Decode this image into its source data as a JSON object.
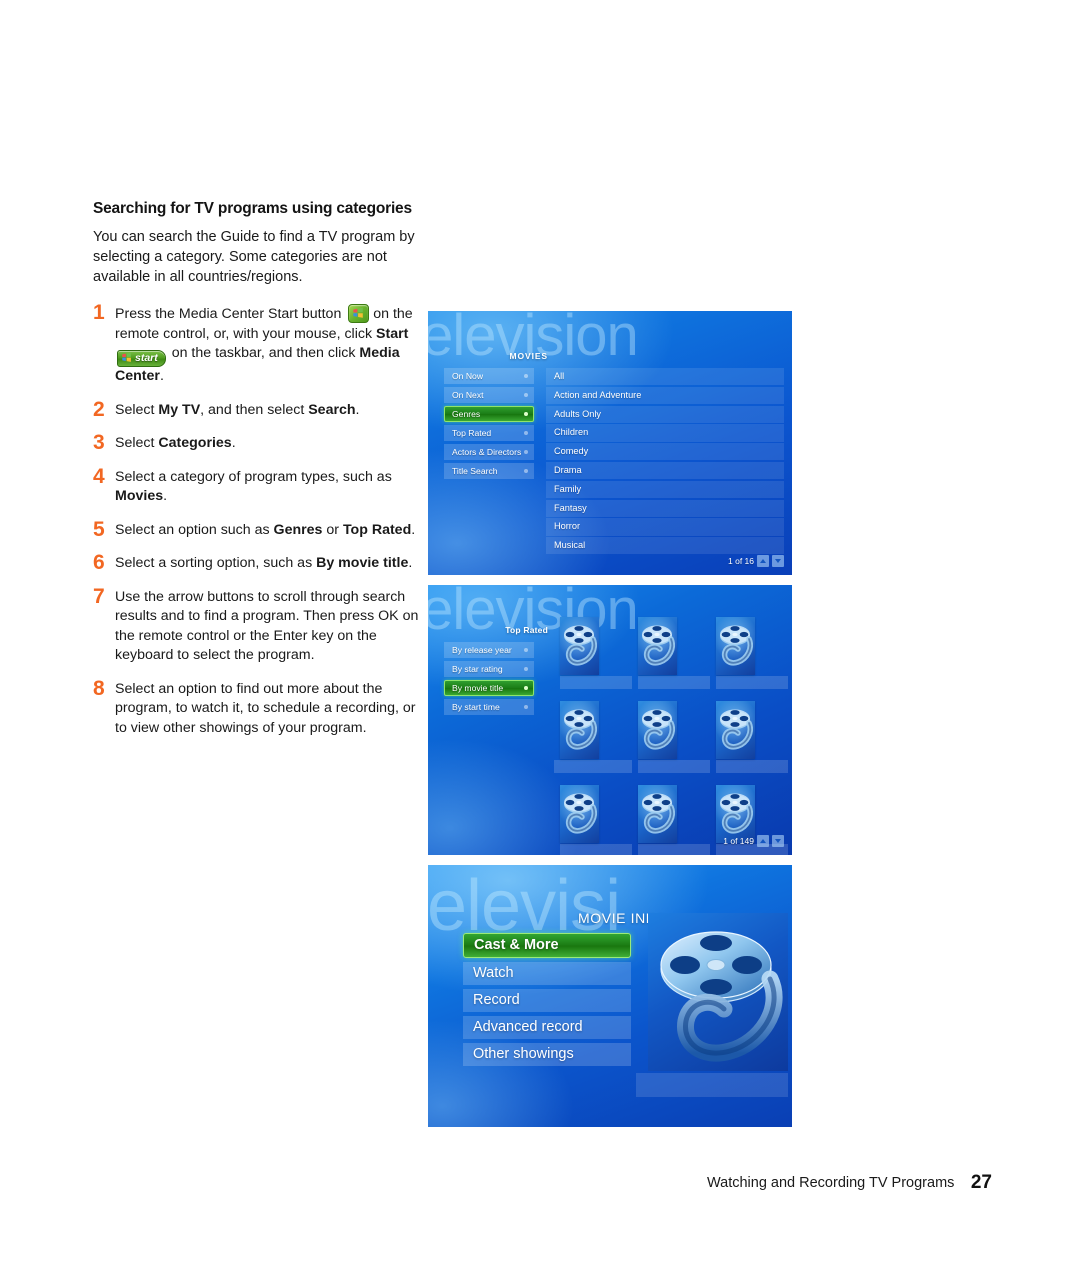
{
  "document": {
    "section_heading": "Searching for TV programs using categories",
    "intro": "You can search the Guide to find a TV program by selecting a category. Some categories are not available in all countries/regions.",
    "footer_text": "Watching and Recording TV Programs",
    "page_number": "27",
    "accent_color": "#F26722"
  },
  "steps": [
    {
      "num": "1",
      "parts": [
        {
          "t": "Press the Media Center Start button ",
          "b": false
        },
        {
          "t": "__MC_ICON__",
          "b": false
        },
        {
          "t": " on the remote control, or, with your mouse, click ",
          "b": false
        },
        {
          "t": "Start",
          "b": true
        },
        {
          "t": "__START_PILL__",
          "b": false
        },
        {
          "t": " on the taskbar, and then click ",
          "b": false
        },
        {
          "t": "Media Center",
          "b": true
        },
        {
          "t": ".",
          "b": false
        }
      ]
    },
    {
      "num": "2",
      "parts": [
        {
          "t": "Select ",
          "b": false
        },
        {
          "t": "My TV",
          "b": true
        },
        {
          "t": ", and then select ",
          "b": false
        },
        {
          "t": "Search",
          "b": true
        },
        {
          "t": ".",
          "b": false
        }
      ]
    },
    {
      "num": "3",
      "parts": [
        {
          "t": "Select ",
          "b": false
        },
        {
          "t": "Categories",
          "b": true
        },
        {
          "t": ".",
          "b": false
        }
      ]
    },
    {
      "num": "4",
      "parts": [
        {
          "t": "Select a category of program types, such as ",
          "b": false
        },
        {
          "t": "Movies",
          "b": true
        },
        {
          "t": ".",
          "b": false
        }
      ]
    },
    {
      "num": "5",
      "parts": [
        {
          "t": "Select an option such as ",
          "b": false
        },
        {
          "t": "Genres",
          "b": true
        },
        {
          "t": " or ",
          "b": false
        },
        {
          "t": "Top Rated",
          "b": true
        },
        {
          "t": ".",
          "b": false
        }
      ]
    },
    {
      "num": "6",
      "parts": [
        {
          "t": "Select a sorting option, such as ",
          "b": false
        },
        {
          "t": "By movie title",
          "b": true
        },
        {
          "t": ".",
          "b": false
        }
      ]
    },
    {
      "num": "7",
      "parts": [
        {
          "t": "Use the arrow buttons to scroll through search results and to find a program. Then press OK on the remote control or the Enter key on the keyboard to select the program.",
          "b": false
        }
      ]
    },
    {
      "num": "8",
      "parts": [
        {
          "t": "Select an option to find out more about the program, to watch it, to schedule a recording, or to view other showings of your program.",
          "b": false
        }
      ]
    }
  ],
  "start_button": {
    "label": "start",
    "icon": "windows-flag-icon"
  },
  "screenshots": {
    "shot1": {
      "watermark": "television",
      "header": "MOVIES",
      "menu": [
        {
          "label": "On Now",
          "selected": false
        },
        {
          "label": "On Next",
          "selected": false
        },
        {
          "label": "Genres",
          "selected": true
        },
        {
          "label": "Top Rated",
          "selected": false
        },
        {
          "label": "Actors & Directors",
          "selected": false
        },
        {
          "label": "Title Search",
          "selected": false
        }
      ],
      "list": [
        "All",
        "Action and Adventure",
        "Adults Only",
        "Children",
        "Comedy",
        "Drama",
        "Family",
        "Fantasy",
        "Horror",
        "Musical"
      ],
      "pager": "1 of 16"
    },
    "shot2": {
      "watermark": "television",
      "header": "Top Rated",
      "menu": [
        {
          "label": "By release year",
          "selected": false
        },
        {
          "label": "By star rating",
          "selected": false
        },
        {
          "label": "By movie title",
          "selected": true
        },
        {
          "label": "By start time",
          "selected": false
        }
      ],
      "thumb_rows": 3,
      "thumb_cols": 3,
      "pager": "1 of 149"
    },
    "shot3": {
      "watermark": "televisi",
      "header": "MOVIE INFO",
      "menu": [
        {
          "label": "Cast & More",
          "selected": true
        },
        {
          "label": "Watch",
          "selected": false
        },
        {
          "label": "Record",
          "selected": false
        },
        {
          "label": "Advanced record",
          "selected": false
        },
        {
          "label": "Other showings",
          "selected": false
        }
      ],
      "image": "film-reel-image"
    }
  }
}
